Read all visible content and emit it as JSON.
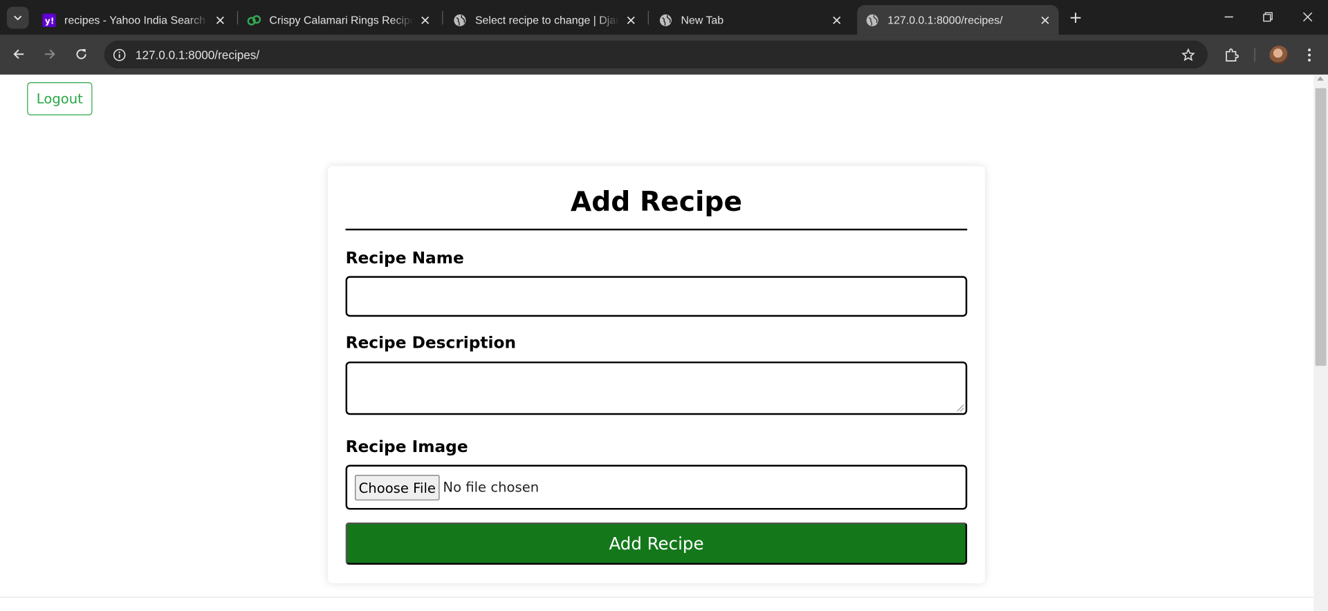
{
  "browser": {
    "tabs": [
      {
        "title": "recipes - Yahoo India Search Re",
        "favicon": "yahoo-icon",
        "active": false
      },
      {
        "title": "Crispy Calamari Rings Recipe by",
        "favicon": "recipe-site-icon",
        "active": false
      },
      {
        "title": "Select recipe to change | Django",
        "favicon": "globe-icon",
        "active": false
      },
      {
        "title": "New Tab",
        "favicon": "globe-icon",
        "active": false
      },
      {
        "title": "127.0.0.1:8000/recipes/",
        "favicon": "globe-icon",
        "active": true
      }
    ],
    "address": "127.0.0.1:8000/recipes/"
  },
  "page": {
    "logout_label": "Logout",
    "form": {
      "heading": "Add Recipe",
      "name_label": "Recipe Name",
      "name_value": "",
      "description_label": "Recipe Description",
      "description_value": "",
      "image_label": "Recipe Image",
      "choose_file_label": "Choose File",
      "file_status": "No file chosen",
      "submit_label": "Add Recipe"
    }
  },
  "colors": {
    "accent_green": "#28a745",
    "submit_green": "#14781b",
    "chrome_dark": "#1f1f1f",
    "toolbar": "#3c3c3c"
  }
}
